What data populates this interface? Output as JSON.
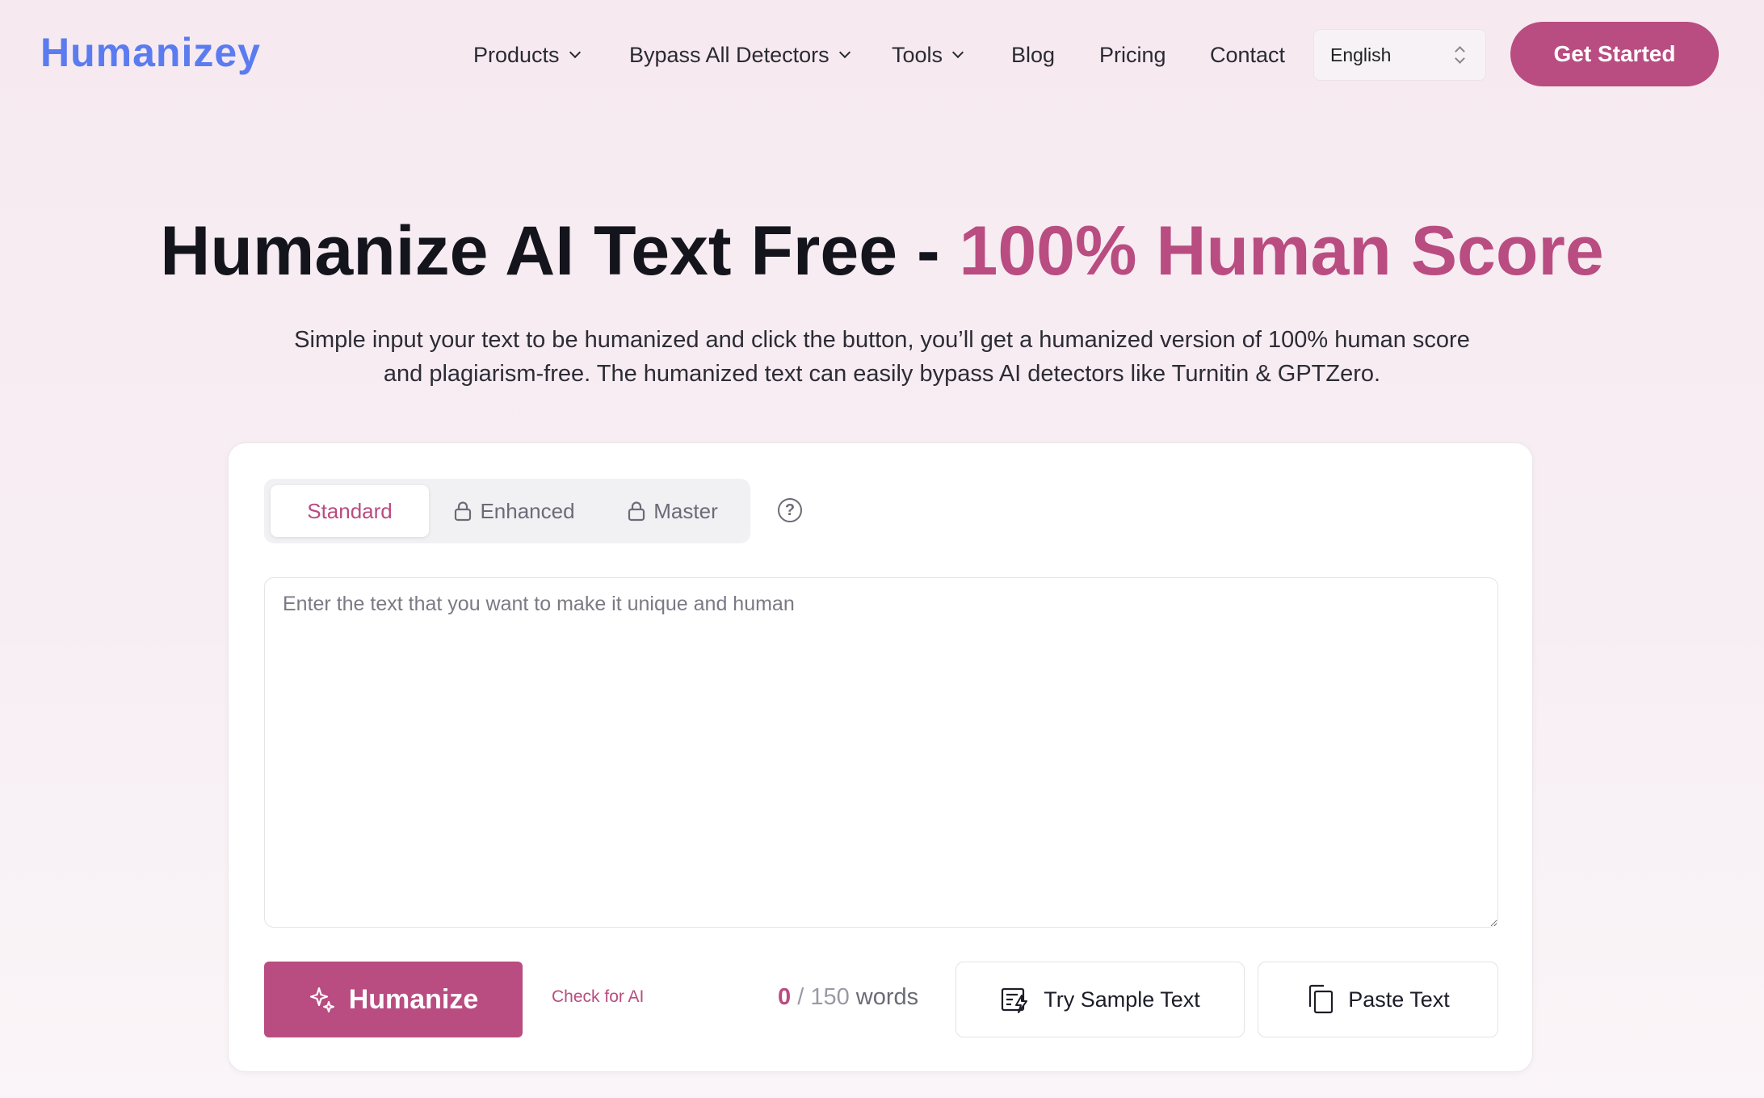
{
  "header": {
    "logo": "Humanizey",
    "nav": [
      {
        "label": "Products",
        "dropdown": true
      },
      {
        "label": "Bypass All Detectors",
        "dropdown": true
      },
      {
        "label": "Tools",
        "dropdown": true
      },
      {
        "label": "Blog",
        "dropdown": false
      },
      {
        "label": "Pricing",
        "dropdown": false
      },
      {
        "label": "Contact",
        "dropdown": false
      }
    ],
    "language": "English",
    "cta": "Get Started"
  },
  "hero": {
    "title_main": "Humanize AI Text Free - ",
    "title_accent": "100% Human Score",
    "subtitle": "Simple input your text to be humanized and click the button, you’ll get a humanized version of 100% human score and plagiarism-free. The humanized text can easily bypass AI detectors like Turnitin & GPTZero."
  },
  "editor": {
    "modes": [
      {
        "label": "Standard",
        "locked": false,
        "active": true
      },
      {
        "label": "Enhanced",
        "locked": true,
        "active": false
      },
      {
        "label": "Master",
        "locked": true,
        "active": false
      }
    ],
    "help_icon": "question-circle-icon",
    "placeholder": "Enter the text that you want to make it unique and human",
    "value": "",
    "humanize_label": "Humanize",
    "check_ai_label": "Check for AI",
    "word_count": "0",
    "word_limit": "/ 150",
    "word_unit": "words",
    "sample_label": "Try Sample Text",
    "paste_label": "Paste Text"
  },
  "colors": {
    "brand": "#b94c80",
    "logo": "#5b7bf0",
    "background": "#f6eaf0"
  }
}
